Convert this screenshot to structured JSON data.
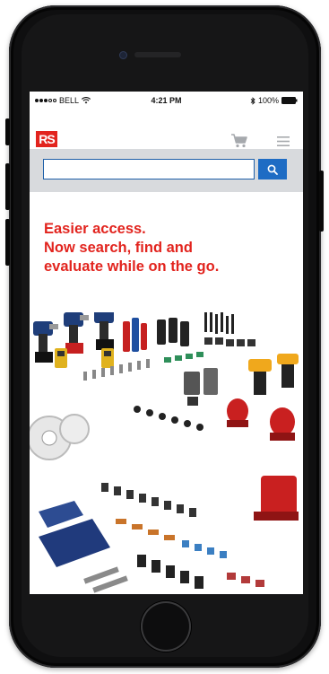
{
  "status_bar": {
    "carrier": "BELL",
    "time": "4:21 PM",
    "battery": "100%",
    "signal_icon": "signal-dots-icon",
    "wifi_icon": "wifi-icon",
    "bluetooth_icon": "bluetooth-icon",
    "battery_icon": "battery-icon"
  },
  "header": {
    "logo_text": "RS",
    "cart_icon": "cart-icon",
    "menu_icon": "hamburger-menu-icon"
  },
  "search": {
    "value": "",
    "button_icon": "search-icon"
  },
  "hero": {
    "lines": [
      "Easier access.",
      "Now search, find and",
      "evaluate while on the go."
    ]
  },
  "colors": {
    "brand_red": "#e2241e",
    "search_blue": "#1e6cc4",
    "search_bar_bg": "#d8dadd"
  }
}
